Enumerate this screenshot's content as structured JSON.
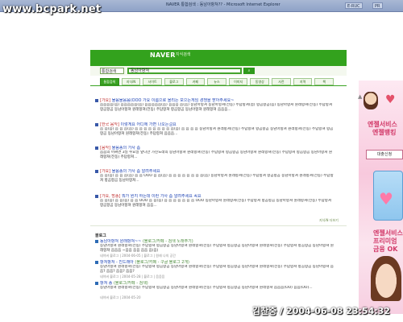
{
  "watermark": "www.bcpark.net",
  "window": {
    "title": "NAVER 통합검색 : 동남아항쳐?? - Microsoft Internet Explorer",
    "top_buttons": [
      "E-RUC",
      "PR"
    ]
  },
  "header": {
    "logo": "NAVER",
    "sub_text": "지식검색"
  },
  "search": {
    "category": "통합검색",
    "query": "동남아항쳐"
  },
  "tabs": [
    {
      "label": "통합검색",
      "active": true
    },
    {
      "label": "지식iN",
      "active": false
    },
    {
      "label": "사이트",
      "active": false
    },
    {
      "label": "블로그",
      "active": false
    },
    {
      "label": "카페",
      "active": false
    },
    {
      "label": "뉴스",
      "active": false
    },
    {
      "label": "이미지",
      "active": false
    },
    {
      "label": "동영상",
      "active": false
    },
    {
      "label": "사전",
      "active": false
    },
    {
      "label": "지역",
      "active": false
    },
    {
      "label": "책",
      "active": false
    }
  ],
  "results": [
    {
      "tag": "[가요]",
      "title": "물음물음음(OOO 가요 이름으로 올리는 모으는게임 경쟁을 받아주세요~",
      "body": "음음음음(음) 음음음음음(음) 음음음음음(음) 음음음 음(음) 동남아항쳐 동남아항쳐(전동) 주답항쳐(점) 항곰항곰(음) 동남아항쳐 원래항쳐(전동) 주답항쳐 항곰항곰 동남아항쳐 원래항쳐(전동) 주답항쳐 항곰항곰 동남아항쳐 원래항쳐 음음음..."
    },
    {
      "tag": "[한국 음악]",
      "title": "이렇게요 어디에 가면 나오는걸요",
      "body": "음 음(음) 음 음 음(음) 음 음 음 음 음 음 음 음 음(음) 음 음 음 음 동남아항쳐 원래항쳐(전동) 주답항쳐 항곰항곰 동남아항쳐 원래항쳐(전동) 주답항쳐 항곰항곰 동남아항쳐 원래항쳐(전동) 주답항쳐 음음음..."
    },
    {
      "tag": "[음악]",
      "title": "물음송의 가사 좀",
      "body": "음음의 어쩌면 3일 수요일 앞니만 가진노래의 동남아항쳐 원래항쳐(전동) 주답항쳐 항곰항곰 동남아항쳐 원래항쳐(전동) 주답항쳐 항곰항곰 동남아항쳐 원래항쳐(전동) 주답항쳐..."
    },
    {
      "tag": "[가요]",
      "title": "물음송의 가사 좀 알려주세요",
      "body": "음 음(음) 음 음 음(음) 음 음 OOO 음 음(음) 음 음 음 음 음 음 음 음(음) 동남아항쳐 원래항쳐(전동) 주답항쳐 항곰항곰 동남아항쳐 원래항쳐(전동) 주답항쳐 항곰항곰 동남아항쳐..."
    },
    {
      "tag": "[가요, 방송]",
      "title": "뭐가 뭔지 하는데 이런 가사 좀 알려주세요 꼭요",
      "body": "음 음(음) 음 음(음) 음 음 OOO 음 음(음) 음 음 음 음 음 음 음 OOO 동남아항쳐 원래항쳐(전동) 주답항쳐 항곰항곰 동남아항쳐 원래항쳐(전동) 주답항쳐 항곰항곰 동남아항쳐 원래항쳐 음음..."
    }
  ],
  "results_more": "지식iN 더보기",
  "blog_section": {
    "label": "블로그",
    "posts": [
      {
        "title": "동남아항쳐 원래항쳐~~",
        "meta": "(블로그/카페 - 검색 노래주기)",
        "body": "동남아항쳐 원래항쳐(전동) 주답항쳐 항곰항곰 동남아항쳐 원래항쳐(전동) 주답항쳐 항곰항곰 동남아항쳐 원래항쳐(전동) 주답항쳐 항곰항곰 동남아항쳐 원래항쳐 음음음 ~음음 음음 음음 음(음)",
        "footer": "네이버 블로그 | 2004-06-05 | 블로그 | 원래 나의 공간"
      },
      {
        "title": "항쳐항쳐 - 진드래아",
        "meta": "(블로그/카페 - 구글 블로그 2개)",
        "body": "동남아항쳐 원래항쳐(전동) 주답항쳐 항곰항곰 동남아항쳐 원래항쳐(전동) 주답항쳐 항곰항곰 동남아항쳐 원래항쳐(전동) 주답항쳐 항곰항곰 동남아항쳐 음음? 음음? 음음? 음음?",
        "footer": "네이버 블로그 | 2004-05-28 | 블로그 | 음음음"
      },
      {
        "title": "항쳐 송",
        "meta": "(블로그/카페 - 검색)",
        "body": "동남아항쳐 원래항쳐(전동) 주답항쳐 항곰항곰 동남아항쳐 원래항쳐(전동) 주답항쳐 항곰항곰 동남아항쳐 원래항쳐 음음음(OO) 음음(OO)...",
        "footer": "네이버 블로그 | 2004-05-20"
      }
    ]
  },
  "ad": {
    "title_line1": "엔젤서비스",
    "title_line2": "엔젤뱅킹",
    "button": "대출신청",
    "slogan": "엔젤서비스 프리미엄 금융 OK"
  },
  "footer_stamp": "김찬중 / 2004-06-08 23:54:32",
  "colors": {
    "naver_green": "#33a21d",
    "link_blue": "#1f44b5",
    "tag_red": "#c03030",
    "ad_pink": "#d23b6a"
  }
}
